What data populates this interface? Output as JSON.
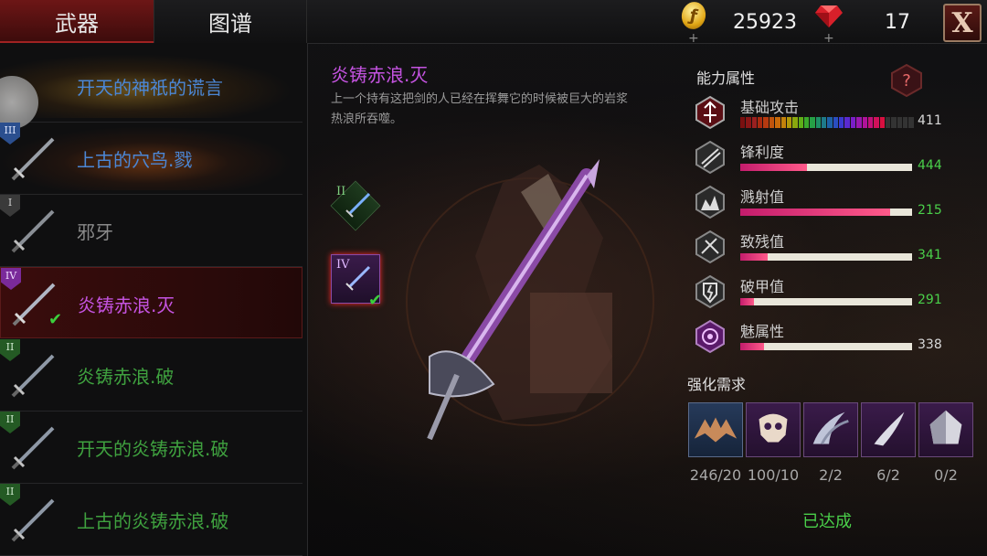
{
  "tabs": [
    {
      "label": "武器"
    },
    {
      "label": "图谱"
    }
  ],
  "currency": {
    "coins": "25923",
    "gems": "17",
    "coin_glyph": "ƒ",
    "plus": "+"
  },
  "close_label": "X",
  "weapons": [
    {
      "rank": "",
      "label": "开天的神祇的谎言",
      "color": "#4b87d6"
    },
    {
      "rank": "III",
      "label": "上古的穴鸟.戮",
      "color": "#4b87d6"
    },
    {
      "rank": "I",
      "label": "邪牙",
      "color": "#8a8a8a"
    },
    {
      "rank": "IV",
      "label": "炎铸赤浪.灭",
      "color": "#c453e0",
      "selected": true
    },
    {
      "rank": "II",
      "label": "炎铸赤浪.破",
      "color": "#3fa13f"
    },
    {
      "rank": "II",
      "label": "开天的炎铸赤浪.破",
      "color": "#3fa13f"
    },
    {
      "rank": "II",
      "label": "上古的炎铸赤浪.破",
      "color": "#3fa13f"
    }
  ],
  "detail": {
    "title": "炎铸赤浪.灭",
    "description": "上一个持有这把剑的人已经在挥舞它的时候被巨大的岩浆热浪所吞噬。",
    "slots": [
      {
        "rank": "II"
      },
      {
        "rank": "IV"
      }
    ]
  },
  "attributes": {
    "title": "能力属性",
    "help": "?",
    "stats": [
      {
        "name": "基础攻击",
        "value": "411",
        "fill": 0.82,
        "icon": "attack-icon",
        "color": "#d8d8d8"
      },
      {
        "name": "锋利度",
        "value": "444",
        "fill": 0.39,
        "icon": "sharpness-icon",
        "color": "#4ad04a"
      },
      {
        "name": "溅射值",
        "value": "215",
        "fill": 0.87,
        "icon": "splash-icon",
        "color": "#4ad04a"
      },
      {
        "name": "致残值",
        "value": "341",
        "fill": 0.16,
        "icon": "cripple-icon",
        "color": "#4ad04a"
      },
      {
        "name": "破甲值",
        "value": "291",
        "fill": 0.08,
        "icon": "armor-break-icon",
        "color": "#4ad04a"
      },
      {
        "name": "魅属性",
        "value": "338",
        "fill": 0.14,
        "icon": "charm-icon",
        "color": "#d8d8d8"
      }
    ]
  },
  "requirements": {
    "title": "强化需求",
    "items": [
      {
        "icon": "bat-wing-icon",
        "count": "246/20"
      },
      {
        "icon": "skull-icon",
        "count": "100/10"
      },
      {
        "icon": "claw-icon",
        "count": "2/2"
      },
      {
        "icon": "fang-icon",
        "count": "6/2"
      },
      {
        "icon": "crystal-icon",
        "count": "0/2"
      }
    ],
    "status": "已达成"
  }
}
